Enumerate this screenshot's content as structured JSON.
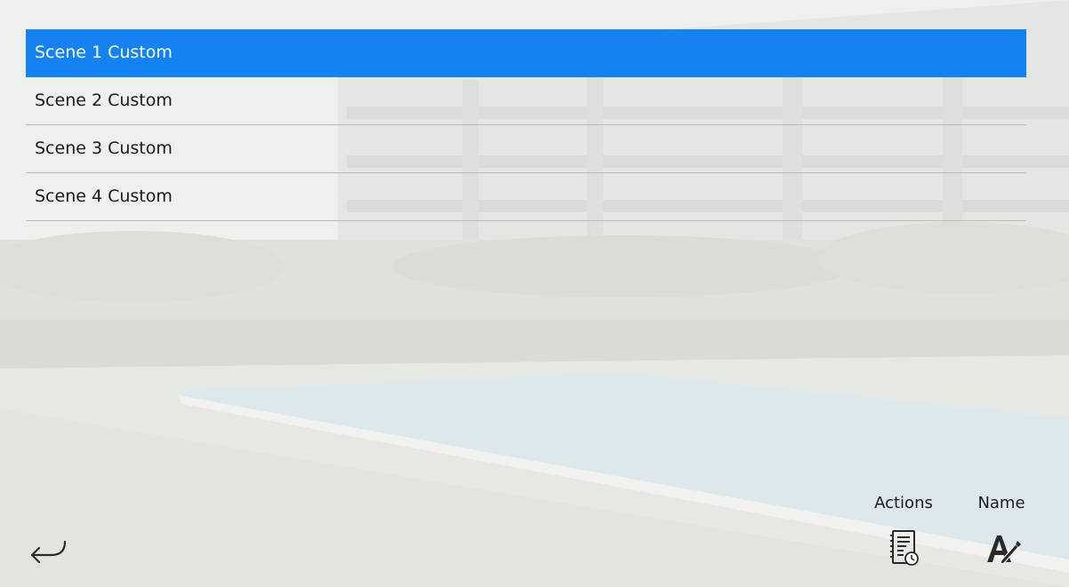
{
  "scenes": [
    {
      "label": "Scene 1 Custom",
      "selected": true
    },
    {
      "label": "Scene 2 Custom",
      "selected": false
    },
    {
      "label": "Scene 3 Custom",
      "selected": false
    },
    {
      "label": "Scene 4 Custom",
      "selected": false
    }
  ],
  "toolbar": {
    "back_icon": "return-arrow-icon",
    "actions_label": "Actions",
    "actions_icon": "schedule-list-icon",
    "name_label": "Name",
    "name_icon": "rename-pencil-icon"
  },
  "colors": {
    "selected_bg": "#1482f0",
    "selected_text": "#ffffff",
    "text": "#1a1a1a"
  }
}
